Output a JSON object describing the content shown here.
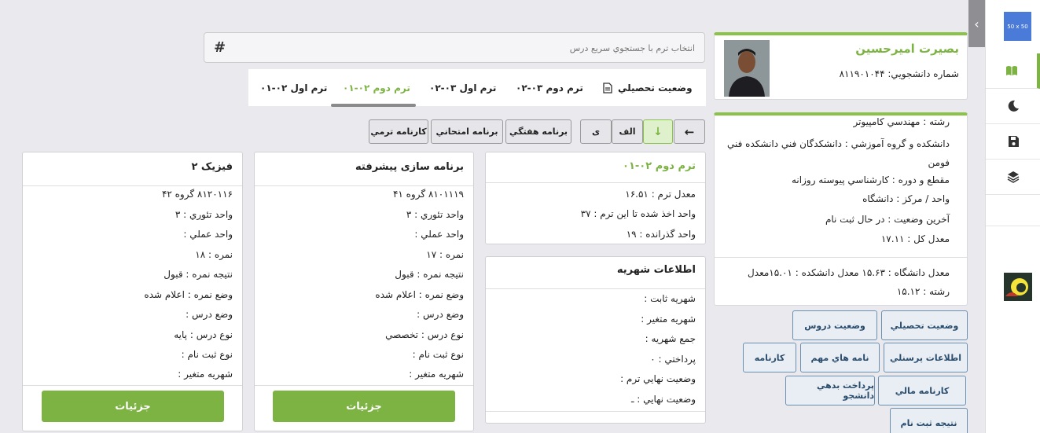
{
  "sidebar": {
    "placeholder_label": "50 x 50",
    "items": [
      "book-icon",
      "moon-icon",
      "save-icon",
      "layers-icon"
    ]
  },
  "student": {
    "name": "بصيرت اميرحسين",
    "number": "شماره دانشجويي: ۸۱۱۹۰۱۰۴۴"
  },
  "info": {
    "major": "رشته : مهندسي کامپيوتر",
    "faculty": "دانشکده و گروه آموزشي : دانشکدگان فني دانشکده فني فومن",
    "level": "مقطع و دوره : کارشناسي پيوسته روزانه",
    "unit": "واحد / مرکز : دانشگاه",
    "status": "آخرين وضعيت : در حال ثبت نام",
    "gpa": "معدل کل : ۱۷.۱۱",
    "averages": "معدل دانشگاه : ۱۵.۶۳ معدل دانشکده : ۱۵.۰۱معدل رشته : ۱۵.۱۲"
  },
  "quick_buttons": [
    "وضعيت تحصيلي",
    "وضعيت دروس",
    "اطلاعات پرسنلي",
    "نامه هاي مهم",
    "کارنامه",
    "کارنامه مالي",
    "پرداخت بدهي دانشجو",
    "نتيجه ثبت نام"
  ],
  "search": {
    "placeholder": "انتخاب ترم با جستجوي سريع درس",
    "hash": "#"
  },
  "tabs": [
    "وضعيت تحصيلي",
    "ترم دوم ۰۳-۰۲",
    "ترم اول ۰۳-۰۲",
    "ترم دوم ۰۲-۰۱",
    "ترم اول ۰۲-۰۱"
  ],
  "toolbar": {
    "arrow_left": "←",
    "arrow_down": "↓",
    "alef": "الف",
    "ye": "ی",
    "weekly": "برنامه هفتگي",
    "exam": "برنامه امتحاني",
    "term_report": "کارنامه ترمي"
  },
  "term": {
    "title": "ترم دوم ۰۲-۰۱",
    "avg": "معدل ترم : ۱۶.۵۱",
    "units_taken": "واحد اخذ شده تا اين ترم : ۳۷",
    "units_passed": "واحد گذرانده : ۱۹"
  },
  "tuition": {
    "title": "اطلاعات شهريه",
    "fixed": "شهريه ثابت :",
    "variable": "شهريه متغير :",
    "total": "جمع شهريه :",
    "paid": "پرداختي : ۰",
    "term_final": "وضعيت نهايي ترم :",
    "final": "وضعيت نهايي : ـ"
  },
  "courses": [
    {
      "title": "برنامه سازی پيشرفته",
      "code": "۸۱۰۱۱۱۹ گروه ۴۱",
      "theory": "واحد تئوري : ۳",
      "practical": "واحد عملي :",
      "grade": "نمره : ۱۷",
      "result": "نتيجه نمره : قبول",
      "grade_status": "وضع نمره : اعلام شده",
      "course_status": "وضع درس :",
      "type": "نوع درس : تخصصي",
      "reg_type": "نوع ثبت نام :",
      "tuition": "شهريه متغير :",
      "button": "جزئيات"
    },
    {
      "title": "فيزيک ۲",
      "code": "۸۱۲۰۱۱۶ گروه ۴۲",
      "theory": "واحد تئوري : ۳",
      "practical": "واحد عملي :",
      "grade": "نمره : ۱۸",
      "result": "نتيجه نمره : قبول",
      "grade_status": "وضع نمره : اعلام شده",
      "course_status": "وضع درس :",
      "type": "نوع درس : پايه",
      "reg_type": "نوع ثبت نام :",
      "tuition": "شهريه متغير :",
      "button": "جزئيات"
    }
  ]
}
